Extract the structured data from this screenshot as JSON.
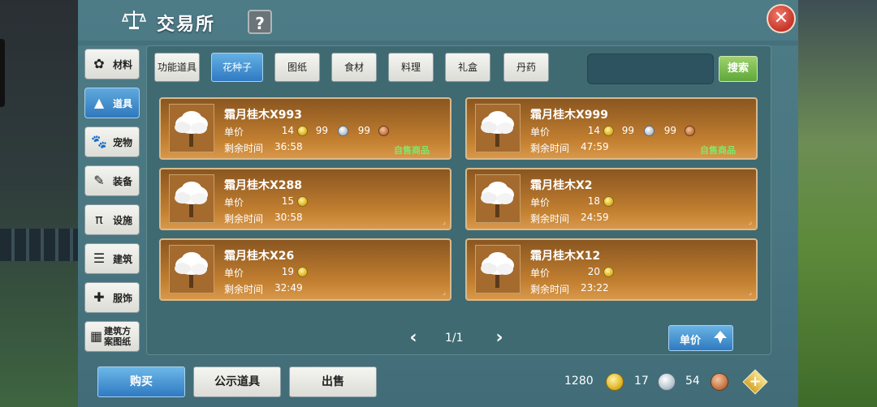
{
  "header": {
    "title": "交易所",
    "help_label": "?",
    "close_label": "✕"
  },
  "sidebar": [
    {
      "label": "材料",
      "icon": "materials-icon",
      "glyph": "✿",
      "active": false
    },
    {
      "label": "道具",
      "icon": "items-icon",
      "glyph": "▲",
      "active": true
    },
    {
      "label": "宠物",
      "icon": "paw-icon",
      "glyph": "🐾",
      "active": false
    },
    {
      "label": "装备",
      "icon": "equipment-icon",
      "glyph": "✎",
      "active": false
    },
    {
      "label": "设施",
      "icon": "facility-icon",
      "glyph": "π",
      "active": false
    },
    {
      "label": "建筑",
      "icon": "building-icon",
      "glyph": "☰",
      "active": false
    },
    {
      "label": "服饰",
      "icon": "clothing-icon",
      "glyph": "✚",
      "active": false
    },
    {
      "label": "建筑方案图纸",
      "icon": "blueprint-icon",
      "glyph": "▦",
      "active": false
    }
  ],
  "tabs": [
    {
      "label": "功能道具",
      "active": false
    },
    {
      "label": "花种子",
      "active": true
    },
    {
      "label": "图纸",
      "active": false
    },
    {
      "label": "食材",
      "active": false
    },
    {
      "label": "料理",
      "active": false
    },
    {
      "label": "礼盒",
      "active": false
    },
    {
      "label": "丹药",
      "active": false
    }
  ],
  "search": {
    "button_label": "搜索",
    "value": ""
  },
  "labels": {
    "unit_price": "单价",
    "time_left": "剩余时间",
    "self_sale": "自售商品"
  },
  "listings": [
    {
      "name": "霜月桂木X993",
      "gold": "14",
      "silver": "99",
      "copper": "99",
      "time": "36:58",
      "self_sale": true
    },
    {
      "name": "霜月桂木X999",
      "gold": "14",
      "silver": "99",
      "copper": "99",
      "time": "47:59",
      "self_sale": true
    },
    {
      "name": "霜月桂木X288",
      "gold": "15",
      "time": "30:58",
      "self_sale": false
    },
    {
      "name": "霜月桂木X2",
      "gold": "18",
      "time": "24:59",
      "self_sale": false
    },
    {
      "name": "霜月桂木X26",
      "gold": "19",
      "time": "32:49",
      "self_sale": false
    },
    {
      "name": "霜月桂木X12",
      "gold": "20",
      "time": "23:22",
      "self_sale": false
    }
  ],
  "pager": {
    "text": "1/1"
  },
  "sort": {
    "label": "单价"
  },
  "bottom": {
    "buy_label": "购买",
    "public_label": "公示道具",
    "sell_label": "出售"
  },
  "currency": {
    "gold": "1280",
    "silver": "17",
    "copper": "54"
  },
  "colors": {
    "panel": "#4a7781",
    "accent_blue": "#2f7ac2",
    "card": "#c27f30",
    "self_sale": "#7fe86a",
    "search_green": "#5ea83a"
  }
}
